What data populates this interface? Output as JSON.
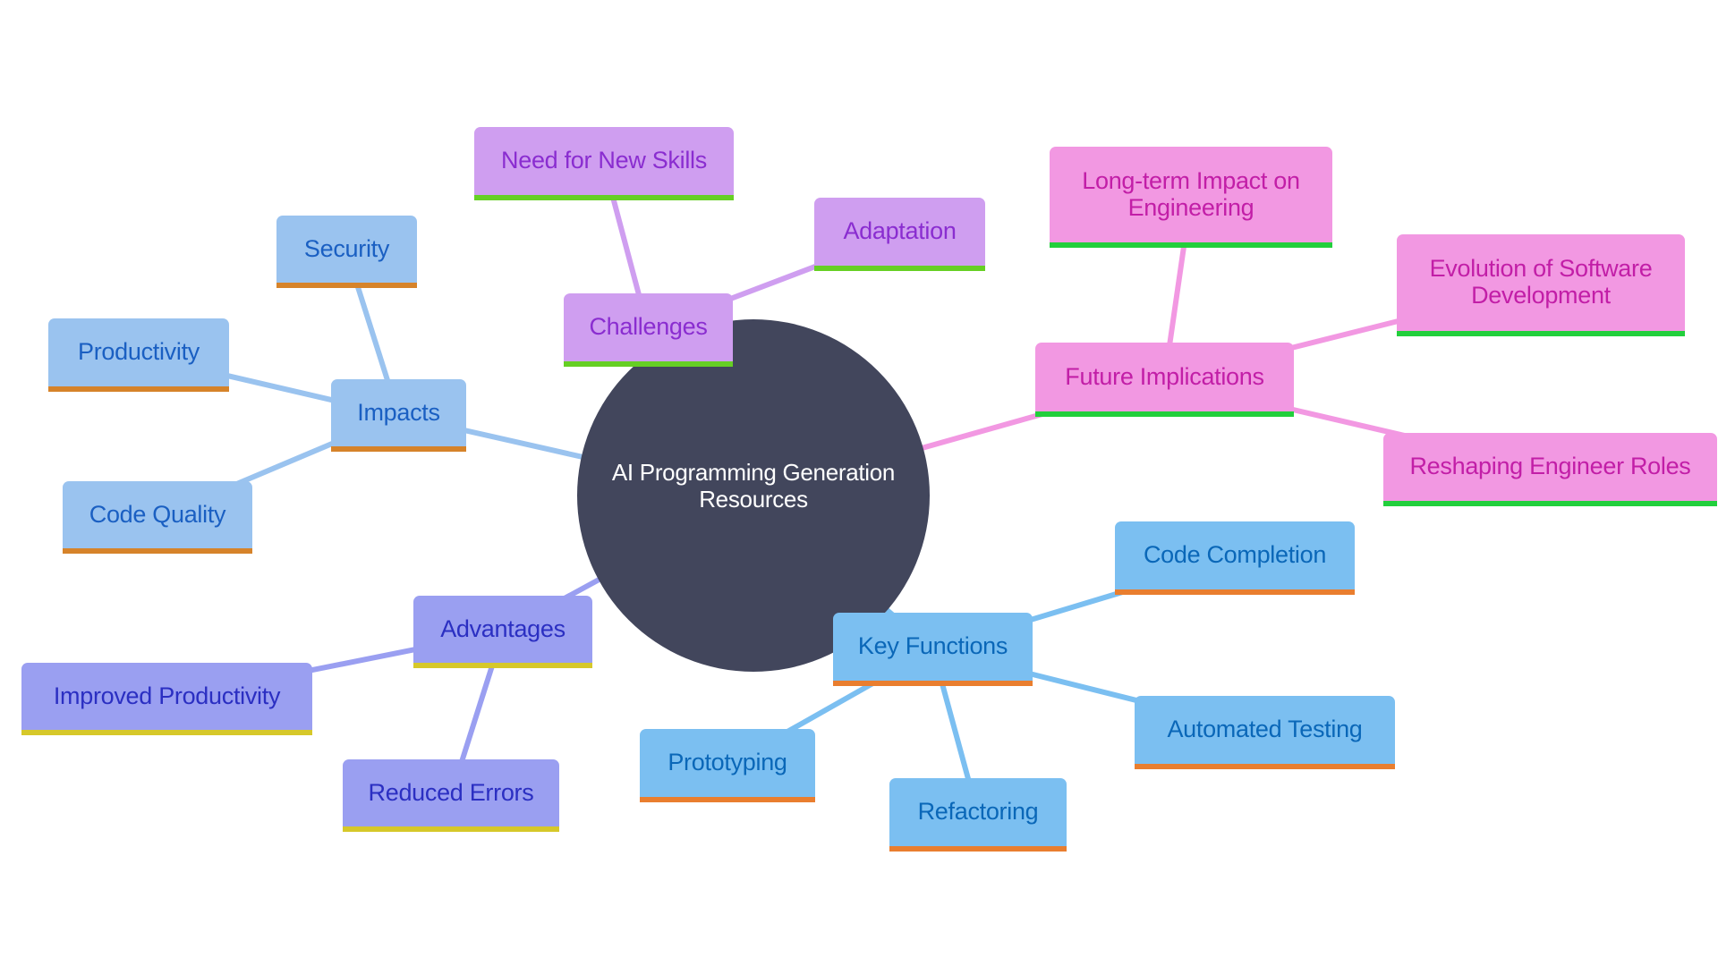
{
  "diagram": {
    "type": "mindmap",
    "root": {
      "label": "AI Programming Generation Resources",
      "color": "#42465c",
      "text_color": "#ffffff"
    },
    "branches": [
      {
        "id": "impacts",
        "label": "Impacts",
        "colors": {
          "fill": "#9ac3ef",
          "text": "#1a5fc2",
          "underline": "#d6832a",
          "edge": "#9ac3ef"
        },
        "children": [
          {
            "id": "security",
            "label": "Security"
          },
          {
            "id": "productivity",
            "label": "Productivity"
          },
          {
            "id": "code-quality",
            "label": "Code Quality"
          }
        ]
      },
      {
        "id": "challenges",
        "label": "Challenges",
        "colors": {
          "fill": "#cf9ef0",
          "text": "#8a2dd0",
          "underline": "#66cf24",
          "edge": "#cf9ef0"
        },
        "children": [
          {
            "id": "need-for-new-skills",
            "label": "Need for New Skills"
          },
          {
            "id": "adaptation",
            "label": "Adaptation"
          }
        ]
      },
      {
        "id": "future-implications",
        "label": "Future Implications",
        "colors": {
          "fill": "#f298e2",
          "text": "#c21ea7",
          "underline": "#22cf3c",
          "edge": "#f298e2"
        },
        "children": [
          {
            "id": "long-term-impact",
            "label": "Long-term Impact on\nEngineering"
          },
          {
            "id": "evolution-software-dev",
            "label": "Evolution of Software\nDevelopment"
          },
          {
            "id": "reshaping-engineer-roles",
            "label": "Reshaping Engineer Roles"
          }
        ]
      },
      {
        "id": "key-functions",
        "label": "Key Functions",
        "colors": {
          "fill": "#7bbff1",
          "text": "#0a67b8",
          "underline": "#e97e2f",
          "edge": "#7bbff1"
        },
        "children": [
          {
            "id": "code-completion",
            "label": "Code Completion"
          },
          {
            "id": "automated-testing",
            "label": "Automated Testing"
          },
          {
            "id": "refactoring",
            "label": "Refactoring"
          },
          {
            "id": "prototyping",
            "label": "Prototyping"
          }
        ]
      },
      {
        "id": "advantages",
        "label": "Advantages",
        "colors": {
          "fill": "#9a9ff1",
          "text": "#2b2fc2",
          "underline": "#d6c82a",
          "edge": "#9a9ff1"
        },
        "children": [
          {
            "id": "improved-productivity",
            "label": "Improved Productivity"
          },
          {
            "id": "reduced-errors",
            "label": "Reduced Errors"
          }
        ]
      }
    ]
  }
}
